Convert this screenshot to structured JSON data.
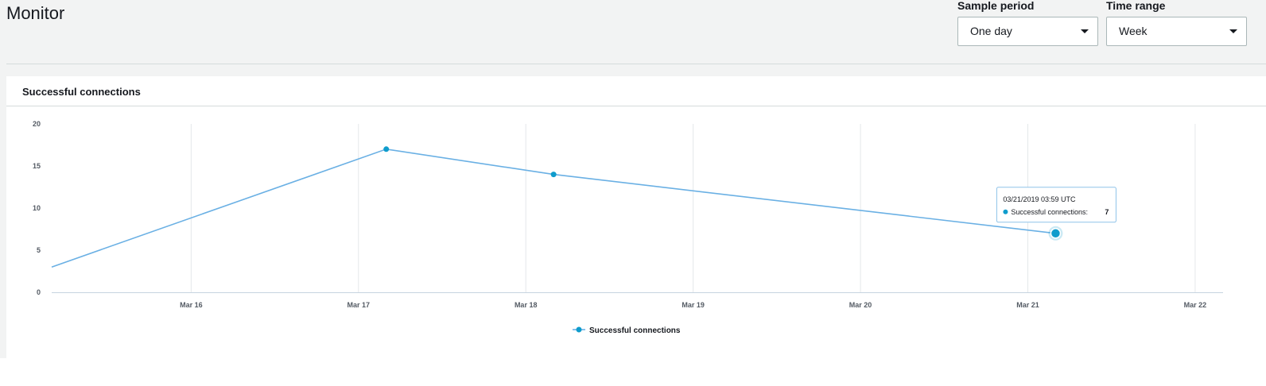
{
  "header": {
    "title": "Monitor"
  },
  "controls": {
    "sample_period": {
      "label": "Sample period",
      "value": "One day"
    },
    "time_range": {
      "label": "Time range",
      "value": "Week"
    }
  },
  "panel": {
    "title": "Successful connections"
  },
  "chart_data": {
    "type": "line",
    "title": "Successful connections",
    "xlabel": "",
    "ylabel": "",
    "x_ticks": [
      "Mar 16",
      "Mar 17",
      "Mar 18",
      "Mar 19",
      "Mar 20",
      "Mar 21",
      "Mar 22"
    ],
    "y_ticks": [
      0,
      5,
      10,
      15,
      20
    ],
    "ylim": [
      0,
      20
    ],
    "xlim": [
      "2019-03-15T04:00",
      "2019-03-22T04:00"
    ],
    "grid": "vertical",
    "legend_position": "bottom",
    "series": [
      {
        "name": "Successful connections",
        "color": "#6ab0e4",
        "marker_color": "#0f9ccc",
        "x": [
          "2019-03-15T04:00",
          "2019-03-17T03:59",
          "2019-03-18T03:59",
          "2019-03-21T03:59"
        ],
        "y": [
          3,
          17,
          14,
          7
        ],
        "markers": [
          false,
          true,
          true,
          true
        ]
      }
    ],
    "tooltip": {
      "timestamp": "03/21/2019 03:59 UTC",
      "series_name": "Successful connections:",
      "value": "7"
    }
  }
}
